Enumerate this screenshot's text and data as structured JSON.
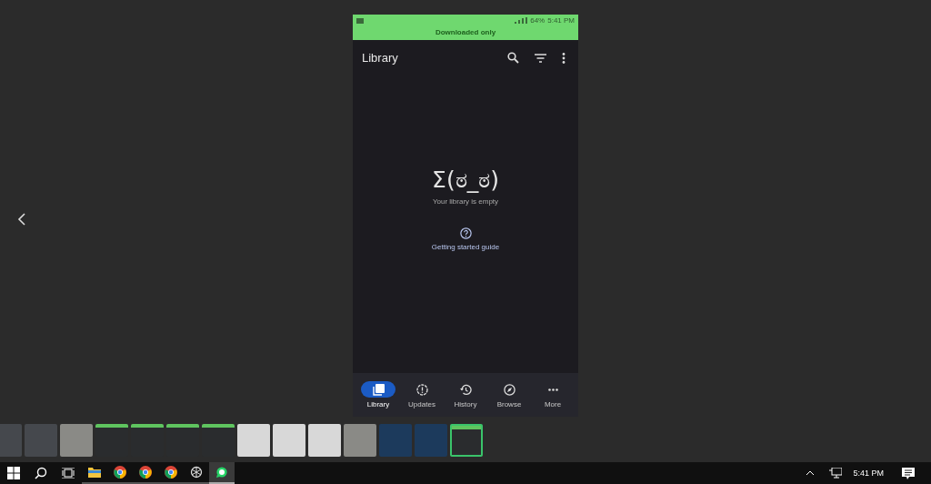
{
  "phone": {
    "status_bar": {
      "battery": "64%",
      "time": "5:41 PM"
    },
    "banner": "Downloaded only",
    "app_bar": {
      "title": "Library"
    },
    "empty_state": {
      "emoticon": "Σ(ಠ_ಠ)",
      "message": "Your library is empty",
      "link": "Getting started guide"
    },
    "nav": [
      {
        "label": "Library",
        "kind": "library",
        "selected": true
      },
      {
        "label": "Updates",
        "kind": "updates",
        "selected": false
      },
      {
        "label": "History",
        "kind": "history",
        "selected": false
      },
      {
        "label": "Browse",
        "kind": "browse",
        "selected": false
      },
      {
        "label": "More",
        "kind": "more",
        "selected": false
      }
    ]
  },
  "filmstrip": [
    {
      "kind": "dark",
      "selected": false
    },
    {
      "kind": "dark",
      "selected": false
    },
    {
      "kind": "photo",
      "selected": false
    },
    {
      "kind": "green",
      "selected": false
    },
    {
      "kind": "green",
      "selected": false
    },
    {
      "kind": "green",
      "selected": false
    },
    {
      "kind": "green",
      "selected": false
    },
    {
      "kind": "light",
      "selected": false
    },
    {
      "kind": "light",
      "selected": false
    },
    {
      "kind": "light",
      "selected": false
    },
    {
      "kind": "photo",
      "selected": false
    },
    {
      "kind": "blue",
      "selected": false
    },
    {
      "kind": "blue",
      "selected": false
    },
    {
      "kind": "green",
      "selected": true
    }
  ],
  "taskbar": {
    "apps": [
      {
        "kind": "folder",
        "active": false
      },
      {
        "kind": "chrome",
        "active": false
      },
      {
        "kind": "chrome",
        "active": false
      },
      {
        "kind": "chrome",
        "active": false
      },
      {
        "kind": "knot",
        "active": false
      },
      {
        "kind": "chat",
        "active": true
      }
    ],
    "clock": "5:41 PM"
  }
}
